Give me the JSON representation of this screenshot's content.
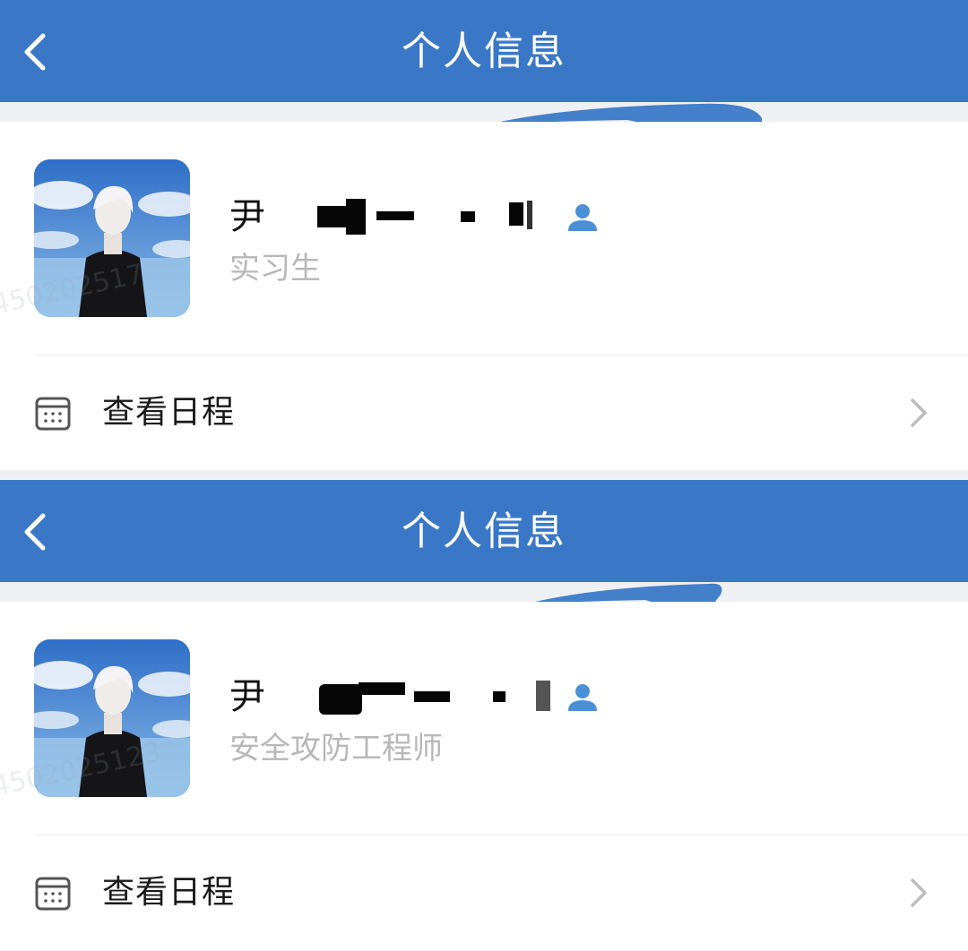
{
  "screens": [
    {
      "nav": {
        "title": "个人信息"
      },
      "profile": {
        "name_visible": "尹",
        "role": "实习生"
      },
      "watermark": "450202517",
      "menu": {
        "schedule_label": "查看日程"
      }
    },
    {
      "nav": {
        "title": "个人信息"
      },
      "profile": {
        "name_visible": "尹",
        "role": "安全攻防工程师"
      },
      "watermark": "4502025123",
      "menu": {
        "schedule_label": "查看日程"
      }
    }
  ],
  "colors": {
    "nav_bar": "#3a78c7",
    "page_bg": "#eef0f3",
    "role_text": "#b8b8b8",
    "user_badge": "#4a90d9"
  },
  "icons": [
    "chevron-left-icon",
    "user-badge-icon",
    "calendar-icon",
    "chevron-right-icon"
  ]
}
